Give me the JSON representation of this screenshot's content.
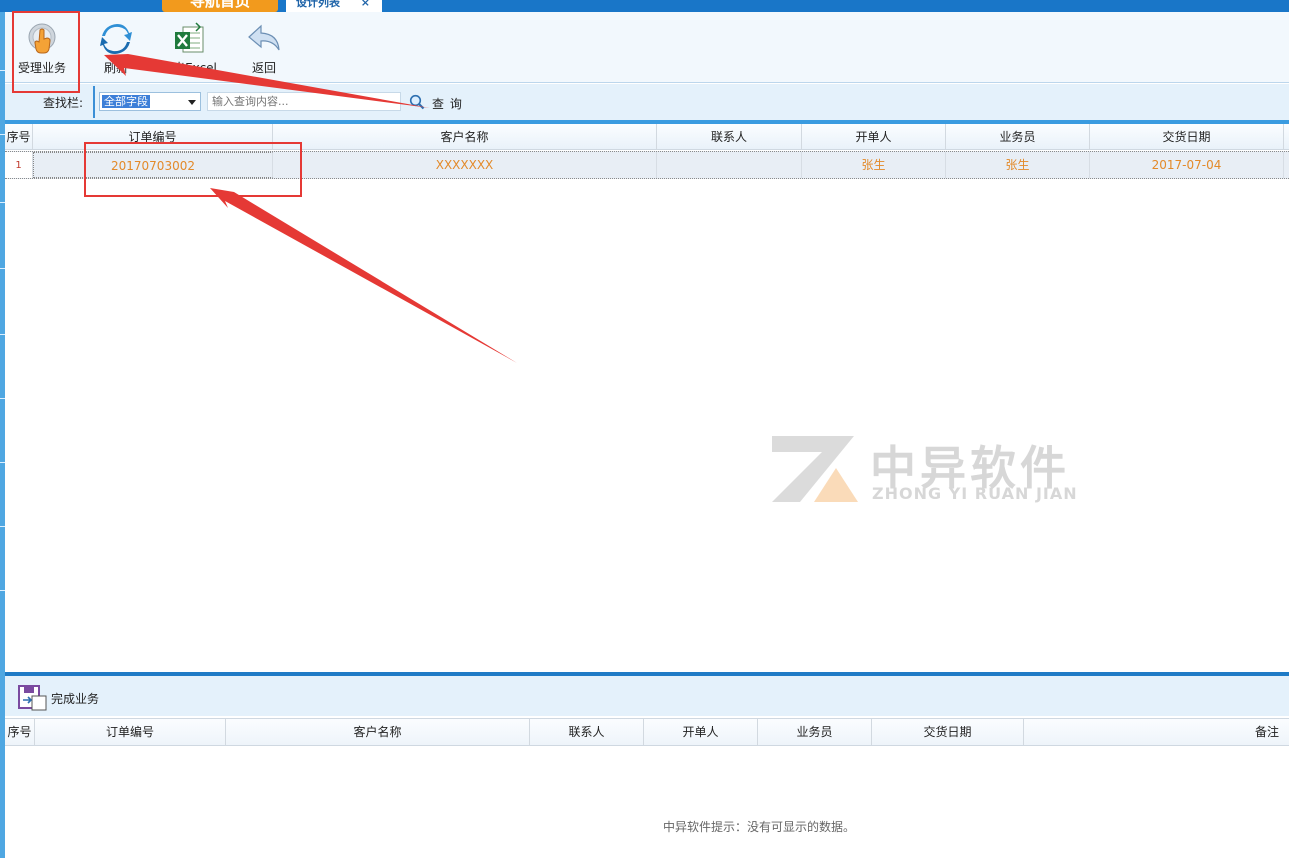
{
  "tabs": {
    "home_label": "导航首页",
    "active_label": "设计列表",
    "close_glyph": "×"
  },
  "toolbar": {
    "accept_label": "受理业务",
    "refresh_label": "刷新",
    "export_label": "导出Excel",
    "back_label": "返回"
  },
  "search": {
    "label": "查找栏:",
    "field_selected": "全部字段",
    "placeholder": "输入查询内容...",
    "button_label": "查 询"
  },
  "grid_top": {
    "columns": [
      "序号",
      "订单编号",
      "客户名称",
      "联系人",
      "开单人",
      "业务员",
      "交货日期"
    ],
    "rows": [
      {
        "index": "1",
        "order_no": "20170703002",
        "customer": "XXXXXXX",
        "contact": "",
        "issuer": "张生",
        "salesman": "张生",
        "delivery_date": "2017-07-04"
      }
    ]
  },
  "watermark": {
    "cn": "中异软件",
    "en": "ZHONG YI RUAN JIAN"
  },
  "bottom": {
    "done_label": "完成业务",
    "columns": [
      "序号",
      "订单编号",
      "客户名称",
      "联系人",
      "开单人",
      "业务员",
      "交货日期",
      "备注"
    ],
    "empty_message": "中异软件提示：没有可显示的数据。"
  },
  "colors": {
    "accent_blue": "#1976c8",
    "tab_orange": "#f29a1d",
    "row_text_orange": "#e38a2a",
    "annotation_red": "#e53935"
  },
  "icons": {
    "accept": "hand-pointer-icon",
    "refresh": "refresh-icon",
    "export": "excel-icon",
    "back": "back-arrow-icon",
    "search": "magnifier-icon",
    "done": "save-icon"
  }
}
